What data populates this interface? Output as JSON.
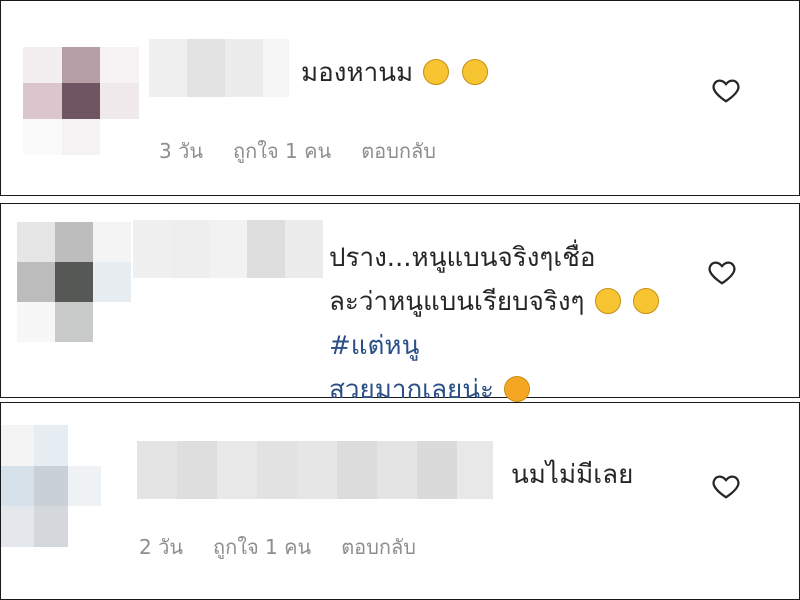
{
  "comments": [
    {
      "text": "มองหานม",
      "emojis": [
        "face-with-tears-of-joy",
        "face-with-tears-of-joy"
      ],
      "time": "3 วัน",
      "likes": "ถูกใจ 1 คน",
      "reply": "ตอบกลับ"
    },
    {
      "line1": "ปราง...หนูแบนจริงๆเชื่อ",
      "line2": "ละว่าหนูแบนเรียบจริงๆ",
      "emojis": [
        "grinning-squinting-face",
        "smiling-face-with-smiling-eyes",
        "smiling-face-with-heart-eyes"
      ],
      "hashtag1": "#แต่หนู",
      "hashtag2": "สวยมากเลยน่ะ"
    },
    {
      "text": "นมไม่มีเลย",
      "time": "2 วัน",
      "likes": "ถูกใจ 1 คน",
      "reply": "ตอบกลับ"
    }
  ],
  "icons": {
    "like": "heart-outline-icon"
  },
  "colors": {
    "hashtag": "#2b4f86",
    "meta": "#8e8e8e",
    "border": "#1a1a1a"
  }
}
